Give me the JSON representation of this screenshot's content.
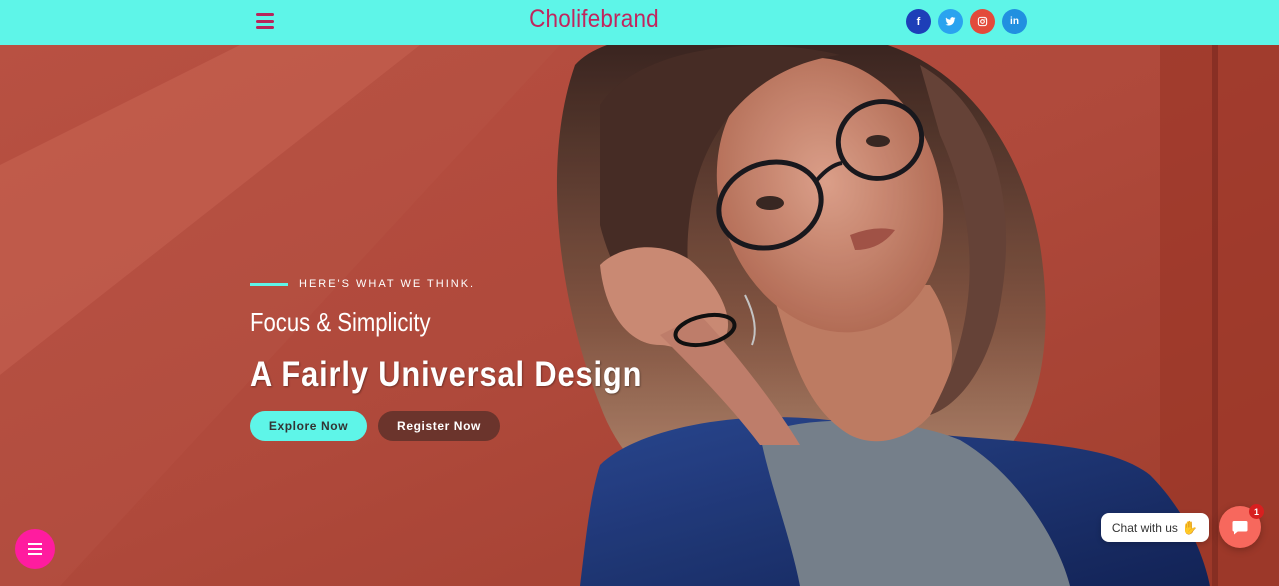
{
  "header": {
    "brand": "Cholifebrand",
    "background": "#5ef5e8",
    "socials": [
      {
        "icon": "facebook-icon",
        "glyph": "f",
        "color": "#1d3fb8"
      },
      {
        "icon": "twitter-icon",
        "glyph": "t",
        "color": "#2aa3ef"
      },
      {
        "icon": "instagram-icon",
        "glyph": "◎",
        "color": "#e34a3b"
      },
      {
        "icon": "linkedin-icon",
        "glyph": "in",
        "color": "#2190e0"
      }
    ]
  },
  "hero": {
    "eyebrow": "HERE'S WHAT WE THINK.",
    "subhead": "Focus & Simplicity",
    "headline": "A Fairly Universal Design",
    "primary_button": "Explore Now",
    "secondary_button": "Register Now"
  },
  "chat": {
    "label": "Chat with us",
    "badge_count": "1",
    "accent": "#f7685d"
  },
  "floating_menu": {
    "icon": "menu-icon",
    "color": "#ff1c9f"
  }
}
